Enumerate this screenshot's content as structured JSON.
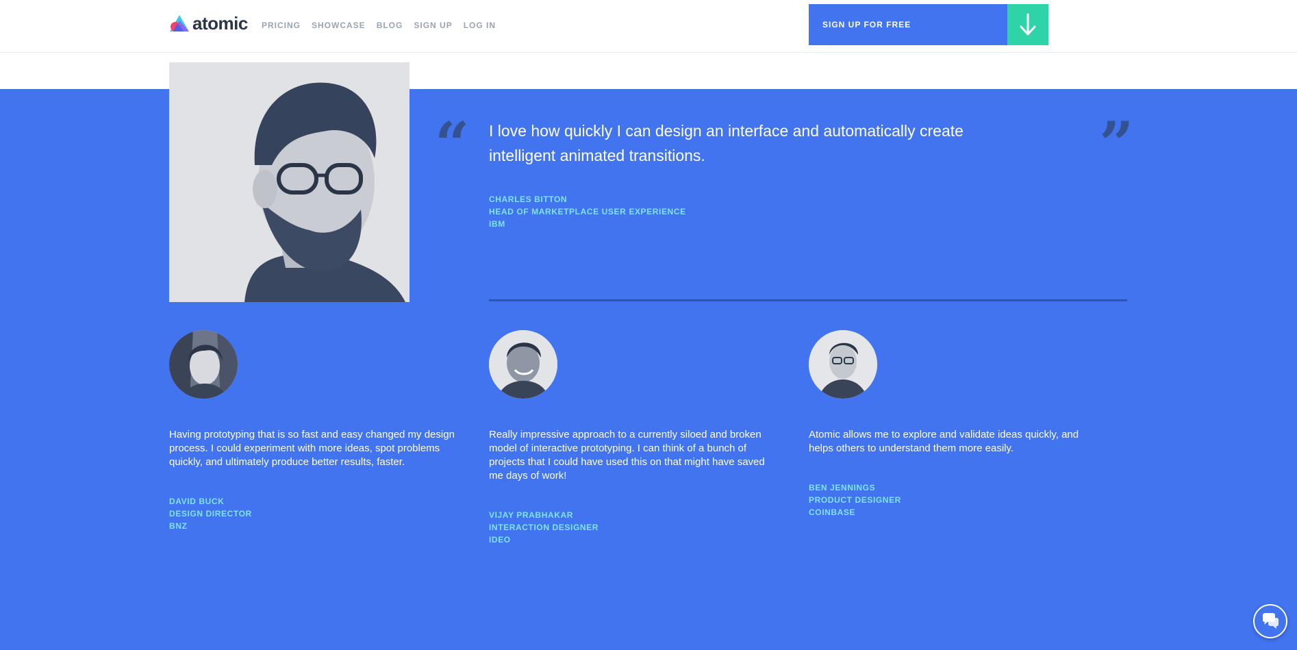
{
  "brand": {
    "name": "atomic"
  },
  "nav": {
    "items": [
      "PRICING",
      "SHOWCASE",
      "BLOG",
      "SIGN UP",
      "LOG IN"
    ]
  },
  "cta": {
    "label": "SIGN UP FOR FREE",
    "icon": "arrow-down-icon"
  },
  "colors": {
    "accent": "#4274f0",
    "cta_arrow_bg": "#2ed3a7",
    "attribution": "#7ee3ff",
    "quote_mark": "#33528f"
  },
  "featured": {
    "quote": "I love how quickly I can design an interface and automatically create intelligent animated transitions.",
    "name": "CHARLES BITTON",
    "title": "HEAD OF MARKETPLACE USER EXPERIENCE",
    "company": "IBM"
  },
  "testimonials": [
    {
      "quote": "Having prototyping that is so fast and easy changed my design process. I could experiment with more ideas, spot problems quickly, and ultimately produce better results, faster.",
      "name": "DAVID BUCK",
      "title": "DESIGN DIRECTOR",
      "company": "BNZ"
    },
    {
      "quote": "Really impressive approach to a currently siloed and broken model of interactive prototyping. I can think of a bunch of projects that I could have used this on that might have saved me days of work!",
      "name": "VIJAY PRABHAKAR",
      "title": "INTERACTION DESIGNER",
      "company": "IDEO"
    },
    {
      "quote": "Atomic allows me to explore and validate ideas quickly, and helps others to understand them more easily.",
      "name": "BEN JENNINGS",
      "title": "PRODUCT DESIGNER",
      "company": "COINBASE"
    }
  ],
  "chat": {
    "icon": "chat-bubbles-icon"
  }
}
